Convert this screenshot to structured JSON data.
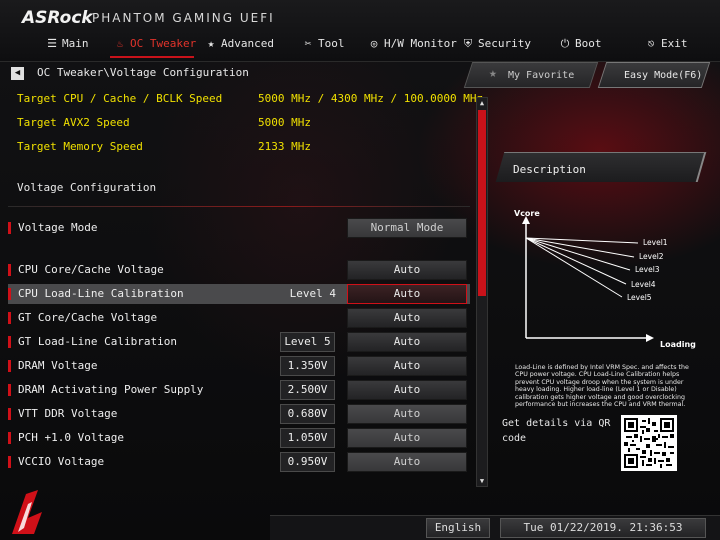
{
  "header": {
    "brand": "ASRock",
    "subtitle": "PHANTOM GAMING UEFI"
  },
  "nav": [
    {
      "label": "Main",
      "icon": "list-icon",
      "glyph": "☰",
      "active": false
    },
    {
      "label": "OC Tweaker",
      "icon": "flame-icon",
      "glyph": "♨",
      "active": true
    },
    {
      "label": "Advanced",
      "icon": "star-icon",
      "glyph": "★",
      "active": false
    },
    {
      "label": "Tool",
      "icon": "tool-icon",
      "glyph": "✂",
      "active": false
    },
    {
      "label": "H/W Monitor",
      "icon": "monitor-icon",
      "glyph": "◎",
      "active": false
    },
    {
      "label": "Security",
      "icon": "shield-icon",
      "glyph": "⛨",
      "active": false
    },
    {
      "label": "Boot",
      "icon": "power-icon",
      "glyph": "⏻",
      "active": false
    },
    {
      "label": "Exit",
      "icon": "exit-icon",
      "glyph": "⎋",
      "active": false
    }
  ],
  "breadcrumb": "OC Tweaker\\Voltage Configuration",
  "targets": [
    {
      "label": "Target CPU / Cache / BCLK Speed",
      "value": "5000 MHz / 4300 MHz / 100.0000 MHz"
    },
    {
      "label": "Target AVX2 Speed",
      "value": "5000 MHz"
    },
    {
      "label": "Target Memory Speed",
      "value": "2133 MHz"
    }
  ],
  "section_title": "Voltage Configuration",
  "rows": [
    {
      "label": "Voltage Mode",
      "level": "",
      "box": "",
      "button": "Normal Mode"
    },
    {
      "label": "CPU Core/Cache Voltage",
      "level": "",
      "box": "",
      "button": "Auto"
    },
    {
      "label": "CPU Load-Line Calibration",
      "level": "Level 4",
      "box": "",
      "button": "Auto"
    },
    {
      "label": "GT Core/Cache Voltage",
      "level": "",
      "box": "",
      "button": "Auto"
    },
    {
      "label": "GT Load-Line Calibration",
      "level": "",
      "box": "Level 5",
      "button": "Auto"
    },
    {
      "label": "DRAM Voltage",
      "level": "",
      "box": "1.350V",
      "button": "Auto"
    },
    {
      "label": "DRAM Activating Power Supply",
      "level": "",
      "box": "2.500V",
      "button": "Auto"
    },
    {
      "label": "VTT DDR Voltage",
      "level": "",
      "box": "0.680V",
      "button": "Auto"
    },
    {
      "label": "PCH +1.0 Voltage",
      "level": "",
      "box": "1.050V",
      "button": "Auto"
    },
    {
      "label": "VCCIO Voltage",
      "level": "",
      "box": "0.950V",
      "button": "Auto"
    }
  ],
  "favorite": {
    "label": "My Favorite"
  },
  "easy_mode": {
    "label": "Easy Mode(F6)"
  },
  "description": {
    "title": "Description",
    "diagram": {
      "y_label": "Vcore",
      "x_label": "Loading",
      "levels": [
        "Level1",
        "Level2",
        "Level3",
        "Level4",
        "Level5"
      ]
    },
    "text": "Load-Line is defined by Intel VRM Spec. and affects the CPU power voltage. CPU Load-Line Calibration helps prevent CPU voltage droop when the system is under heavy loading. Higher load-line (Level 1 or Disable) calibration gets higher voltage and good overclocking performance but increases the CPU and VRM thermal.",
    "qr_text": "Get details via QR code"
  },
  "footer": {
    "language": "English",
    "datetime": "Tue 01/22/2019. 21:36:53"
  },
  "colors": {
    "accent": "#c8121a",
    "target_text": "#f0e000",
    "background": "#0b0b0c"
  }
}
